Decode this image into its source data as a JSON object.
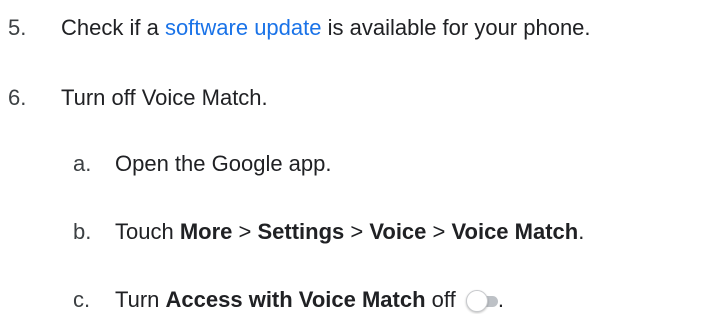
{
  "steps": [
    {
      "number": "5.",
      "before": "Check if a ",
      "link": "software update",
      "after": " is available for your phone."
    },
    {
      "number": "6.",
      "text": "Turn off Voice Match."
    }
  ],
  "substeps": [
    {
      "letter": "a.",
      "text": "Open the Google app."
    },
    {
      "letter": "b.",
      "prefix": "Touch ",
      "path": [
        "More",
        "Settings",
        "Voice",
        "Voice Match"
      ],
      "separator": " > ",
      "suffix": "."
    },
    {
      "letter": "c.",
      "prefix": "Turn ",
      "bold": "Access with Voice Match",
      "middle": " off ",
      "suffix": ".",
      "toggle_state": "off",
      "toggle_icon": "toggle-off-icon"
    }
  ],
  "colors": {
    "text": "#202124",
    "link": "#1a73e8",
    "toggle_track": "#bdc1c6"
  }
}
